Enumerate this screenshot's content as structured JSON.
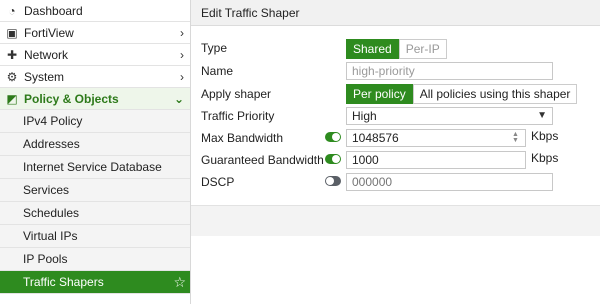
{
  "sidebar": {
    "items": [
      {
        "label": "Dashboard",
        "icon": "dashboard-icon",
        "glyph": "◔",
        "chevron": ""
      },
      {
        "label": "FortiView",
        "icon": "fortiview-icon",
        "glyph": "▣",
        "chevron": "›"
      },
      {
        "label": "Network",
        "icon": "network-icon",
        "glyph": "✚",
        "chevron": "›"
      },
      {
        "label": "System",
        "icon": "system-icon",
        "glyph": "⚙",
        "chevron": "›"
      },
      {
        "label": "Policy & Objects",
        "icon": "policy-icon",
        "glyph": "◩",
        "chevron": "⌄"
      }
    ],
    "sub_items": [
      {
        "label": "IPv4 Policy"
      },
      {
        "label": "Addresses"
      },
      {
        "label": "Internet Service Database"
      },
      {
        "label": "Services"
      },
      {
        "label": "Schedules"
      },
      {
        "label": "Virtual IPs"
      },
      {
        "label": "IP Pools"
      },
      {
        "label": "Traffic Shapers",
        "active": true,
        "star": "☆"
      }
    ]
  },
  "main": {
    "title": "Edit Traffic Shaper",
    "type": {
      "label": "Type",
      "options": [
        "Shared",
        "Per-IP"
      ],
      "selected": "Shared"
    },
    "name": {
      "label": "Name",
      "value": "high-priority"
    },
    "apply_shaper": {
      "label": "Apply shaper",
      "options": [
        "Per policy",
        "All policies using this shaper"
      ],
      "selected": "Per policy"
    },
    "traffic_priority": {
      "label": "Traffic Priority",
      "value": "High",
      "caret": "▼"
    },
    "max_bandwidth": {
      "label": "Max Bandwidth",
      "enabled": true,
      "value": "1048576",
      "unit": "Kbps"
    },
    "guaranteed_bandwidth": {
      "label": "Guaranteed Bandwidth",
      "enabled": true,
      "value": "1000",
      "unit": "Kbps"
    },
    "dscp": {
      "label": "DSCP",
      "enabled": false,
      "placeholder": "000000"
    }
  },
  "colors": {
    "accent": "#2e8b1f",
    "toggle_off": "#5a5f66"
  }
}
